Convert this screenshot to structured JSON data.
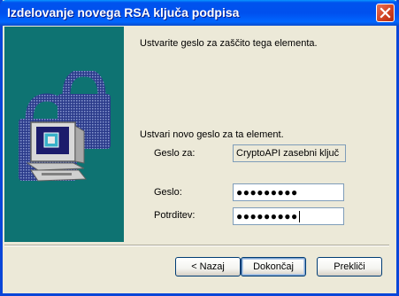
{
  "window": {
    "title": "Izdelovanje novega RSA ključa podpisa",
    "close_icon": "close-icon"
  },
  "content": {
    "intro": "Ustvarite geslo za zaščito tega elementa.",
    "subheading": "Ustvari novo geslo za ta element.",
    "password_for_label": "Geslo za:",
    "password_for_value": "CryptoAPI zasebni ključ",
    "password_label": "Geslo:",
    "password_value": "●●●●●●●●●",
    "confirm_label": "Potrditev:",
    "confirm_value": "●●●●●●●●●"
  },
  "buttons": {
    "back": "< Nazaj",
    "finish": "Dokončaj",
    "cancel": "Prekliči"
  },
  "colors": {
    "titlebar": "#0054e3",
    "side_panel": "#0e7372",
    "dialog_bg": "#ece9d8"
  }
}
